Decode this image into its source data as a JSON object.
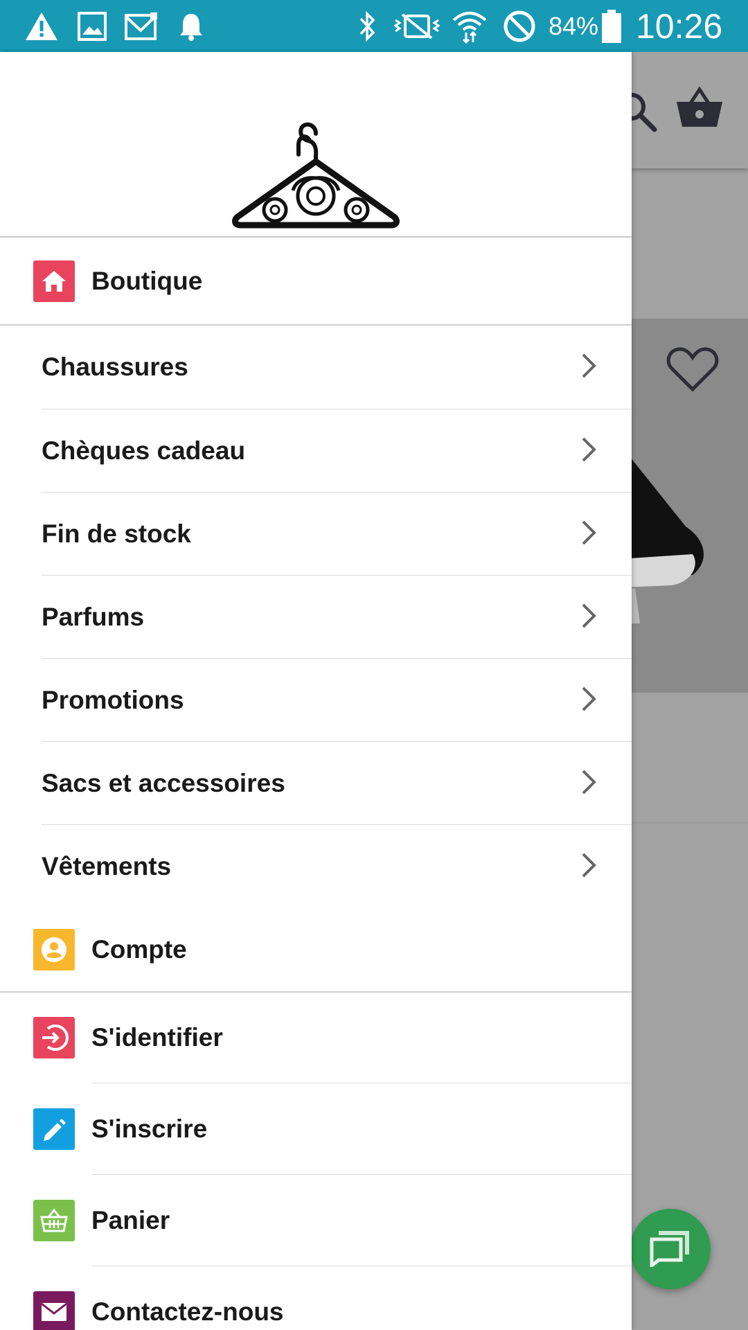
{
  "status_bar": {
    "battery_percent": "84%",
    "time": "10:26",
    "icons": [
      "warning-icon",
      "image-icon",
      "email-icon",
      "bell-icon",
      "bluetooth-icon",
      "vibrate-icon",
      "wifi-icon",
      "do-not-disturb-icon",
      "battery-icon"
    ]
  },
  "drawer": {
    "logo": "hanger-logo",
    "home": {
      "label": "Boutique",
      "icon": "home-icon",
      "color": "#e8445e"
    },
    "categories": [
      {
        "label": "Chaussures"
      },
      {
        "label": "Chèques cadeau"
      },
      {
        "label": "Fin de stock"
      },
      {
        "label": "Parfums"
      },
      {
        "label": "Promotions"
      },
      {
        "label": "Sacs et accessoires"
      },
      {
        "label": "Vêtements"
      }
    ],
    "account": {
      "label": "Compte",
      "icon": "user-icon",
      "color": "#f8b72d"
    },
    "account_items": [
      {
        "label": "S'identifier",
        "icon": "login-icon",
        "color": "#e8445e"
      },
      {
        "label": "S'inscrire",
        "icon": "pencil-icon",
        "color": "#129fe0"
      },
      {
        "label": "Panier",
        "icon": "basket-icon",
        "color": "#7bc04b"
      },
      {
        "label": "Contactez-nous",
        "icon": "envelope-icon",
        "color": "#7a1a5e"
      }
    ]
  },
  "background": {
    "toolbar_icons": [
      "search-icon",
      "basket-icon"
    ],
    "product_icon": "heart-icon",
    "fab_icon": "chat-icon",
    "fab_color": "#2f9c51"
  }
}
